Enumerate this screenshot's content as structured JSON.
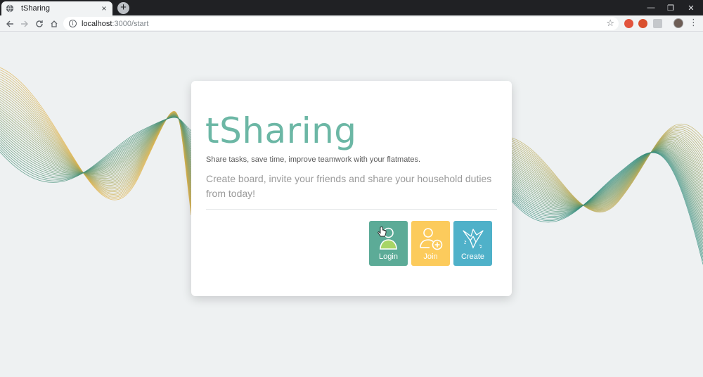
{
  "browser": {
    "tab_title": "tSharing",
    "tab_close": "×",
    "new_tab": "+",
    "url_host": "localhost",
    "url_path": ":3000/start",
    "window_controls": [
      "—",
      "❐",
      "✕"
    ],
    "nav_icons": [
      "back-icon",
      "forward-icon",
      "reload-icon",
      "home-icon"
    ]
  },
  "card": {
    "title": "tSharing",
    "tagline": "Share tasks, save time, improve teamwork with your flatmates.",
    "description": "Create board, invite your friends and share your household duties from today!"
  },
  "actions": [
    {
      "label": "Login",
      "color": "#5cab97",
      "icon": "user-icon"
    },
    {
      "label": "Join",
      "color": "#fccb5c",
      "icon": "add-user-icon"
    },
    {
      "label": "Create",
      "color": "#4fb1c9",
      "icon": "paper-crane-icon"
    }
  ],
  "colors": {
    "brand": "#6cb7a5",
    "wave_teal": "#2f8a7a",
    "wave_gold": "#e0b34a"
  }
}
